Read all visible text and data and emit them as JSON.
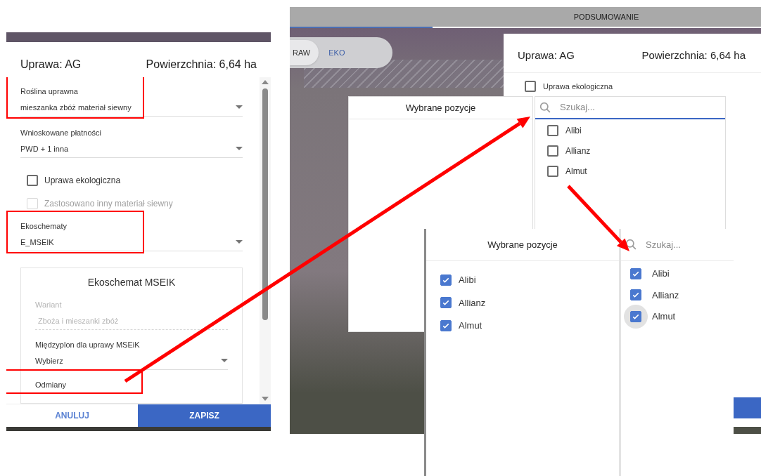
{
  "left_dialog": {
    "title": "Uprawa: AG",
    "area": "Powierzchnia: 6,64 ha",
    "fields": [
      {
        "kind": "select",
        "label": "Roślina uprawna",
        "value": "mieszanka zbóż materiał siewny",
        "highlighted": true
      },
      {
        "kind": "select",
        "label": "Wnioskowane płatności",
        "value": "PWD + 1 inna",
        "highlighted": false
      },
      {
        "kind": "checkbox",
        "label": "Uprawa ekologiczna",
        "checked": false,
        "disabled": false
      },
      {
        "kind": "checkbox",
        "label": "Zastosowano inny materiał siewny",
        "checked": false,
        "disabled": true
      },
      {
        "kind": "select",
        "label": "Ekoschematy",
        "value": "E_MSEIK",
        "highlighted": true
      }
    ],
    "section": {
      "title": "Ekoschemat MSEIK",
      "fields": [
        {
          "kind": "readonly",
          "label": "Wariant",
          "value": "Zboża i mieszanki zbóż",
          "highlighted": false
        },
        {
          "kind": "select",
          "label": "Międzyplon dla uprawy MSEiK",
          "value": "Wybierz",
          "highlighted": false
        },
        {
          "kind": "label",
          "label": "Odmiany",
          "highlighted": true
        }
      ]
    },
    "buttons": {
      "cancel": "ANULUJ",
      "save": "ZAPISZ"
    }
  },
  "map_view": {
    "tab": "PODSUMOWANIE",
    "toggle": [
      {
        "label": "RAW",
        "selected": true
      },
      {
        "label": "EKO",
        "selected": false
      }
    ],
    "dialog": {
      "title": "Uprawa: AG",
      "area": "Powierzchnia: 6,64 ha",
      "checkbox": {
        "label": "Uprawa ekologiczna",
        "checked": false
      }
    },
    "picker": {
      "selected_title": "Wybrane pozycje",
      "search_placeholder": "Szukaj...",
      "options": [
        {
          "label": "Alibi",
          "checked": false
        },
        {
          "label": "Allianz",
          "checked": false
        },
        {
          "label": "Almut",
          "checked": false
        }
      ]
    }
  },
  "picker_after": {
    "selected_title": "Wybrane pozycje",
    "search_placeholder": "Szukaj...",
    "selected_items": [
      {
        "label": "Alibi",
        "checked": true
      },
      {
        "label": "Allianz",
        "checked": true
      },
      {
        "label": "Almut",
        "checked": true
      }
    ],
    "options": [
      {
        "label": "Alibi",
        "checked": true,
        "focused": false
      },
      {
        "label": "Allianz",
        "checked": true,
        "focused": false
      },
      {
        "label": "Almut",
        "checked": true,
        "focused": true
      }
    ]
  }
}
